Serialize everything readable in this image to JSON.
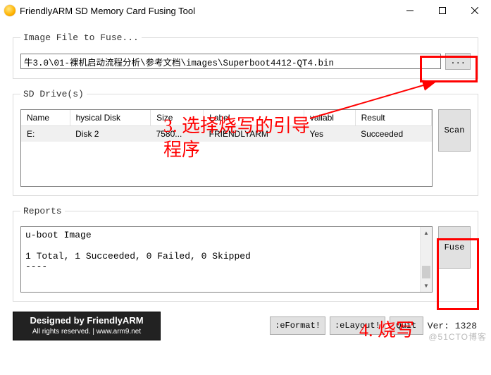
{
  "window": {
    "title": "FriendlyARM SD Memory Card Fusing Tool"
  },
  "groups": {
    "image_file": "Image File to Fuse...",
    "sd_drives": "SD Drive(s)",
    "reports": "Reports"
  },
  "file": {
    "path": "牛3.0\\01-裸机启动流程分析\\参考文档\\images\\Superboot4412-QT4.bin",
    "browse": "..."
  },
  "drives": {
    "columns": [
      "Name",
      "hysical Disk",
      "Size",
      "Label",
      "vailabl",
      "Result"
    ],
    "rows": [
      {
        "name": "E:",
        "disk": "Disk 2",
        "size": "7580...",
        "label": "FRIENDLYARM",
        "avail": "Yes",
        "result": "Succeeded"
      }
    ],
    "scan": "Scan"
  },
  "reports": {
    "text": "u-boot Image\n\n1 Total, 1 Succeeded, 0 Failed, 0 Skipped\n----",
    "fuse": "Fuse"
  },
  "footer": {
    "banner_line1": "Designed by FriendlyARM",
    "banner_line2": "All rights reserved. | www.arm9.net",
    "reformat": ":eFormat!",
    "relayout": ":eLayout!",
    "quit": "Quit",
    "version": "Ver: 1328"
  },
  "annotations": {
    "step3": "3. 选择烧写的引导程序",
    "step3_line2": "程序",
    "step4": "4. 烧写"
  },
  "watermark": "@51CTO博客"
}
